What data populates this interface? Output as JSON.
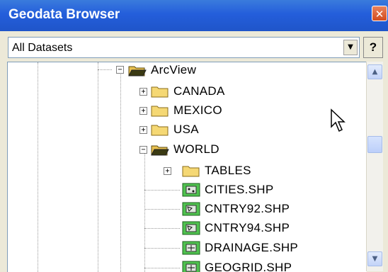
{
  "window": {
    "title": "Geodata Browser",
    "close_glyph": "✕"
  },
  "combo": {
    "value": "All Datasets",
    "arrow": "▼"
  },
  "help": {
    "label": "?"
  },
  "tree": {
    "items": [
      {
        "label": "ArcView",
        "kind": "folder-open",
        "expander": "−"
      },
      {
        "label": "CANADA",
        "kind": "folder",
        "expander": "+"
      },
      {
        "label": "MEXICO",
        "kind": "folder",
        "expander": "+"
      },
      {
        "label": "USA",
        "kind": "folder",
        "expander": "+"
      },
      {
        "label": "WORLD",
        "kind": "folder-open",
        "expander": "−"
      },
      {
        "label": "TABLES",
        "kind": "folder",
        "expander": "+"
      },
      {
        "label": "CITIES.SHP",
        "kind": "point-shapefile"
      },
      {
        "label": "CNTRY92.SHP",
        "kind": "polygon-shapefile"
      },
      {
        "label": "CNTRY94.SHP",
        "kind": "polygon-shapefile"
      },
      {
        "label": "DRAINAGE.SHP",
        "kind": "line-shapefile"
      },
      {
        "label": "GEOGRID.SHP",
        "kind": "line-shapefile"
      }
    ]
  },
  "scrollbar": {
    "up": "▲",
    "down": "▼"
  },
  "icons": {
    "cursor": "arrow-cursor-icon"
  }
}
